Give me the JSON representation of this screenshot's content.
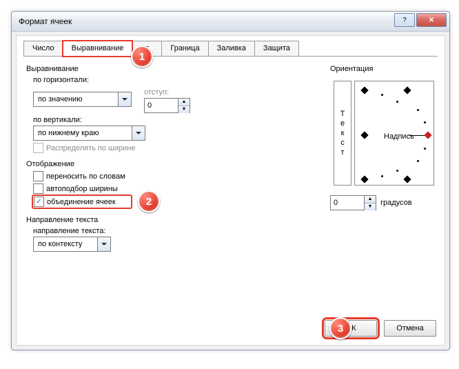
{
  "window": {
    "title": "Формат ячеек"
  },
  "tabs": {
    "number": "Число",
    "alignment": "Выравнивание",
    "trimmed": "т",
    "border": "Граница",
    "fill": "Заливка",
    "protection": "Защита"
  },
  "alignment": {
    "section": "Выравнивание",
    "horizontal_label": "по горизонтали:",
    "horizontal_value": "по значению",
    "indent_label": "отступ:",
    "indent_value": "0",
    "vertical_label": "по вертикали:",
    "vertical_value": "по нижнему краю",
    "distribute_label": "Распределять по ширине"
  },
  "display": {
    "section": "Отображение",
    "wrap_label": "переносить по словам",
    "autofit_label": "автоподбор ширины",
    "merge_label": "объединение ячеек"
  },
  "text_direction": {
    "section": "Направление текста",
    "field_label": "направление текста:",
    "value": "по контексту"
  },
  "orientation": {
    "section": "Ориентация",
    "vertical_word": "Текст",
    "caption": "Надпись",
    "degrees_value": "0",
    "degrees_label": "градусов"
  },
  "footer": {
    "ok": "ОК",
    "cancel": "Отмена"
  },
  "badges": {
    "b1": "1",
    "b2": "2",
    "b3": "3"
  }
}
